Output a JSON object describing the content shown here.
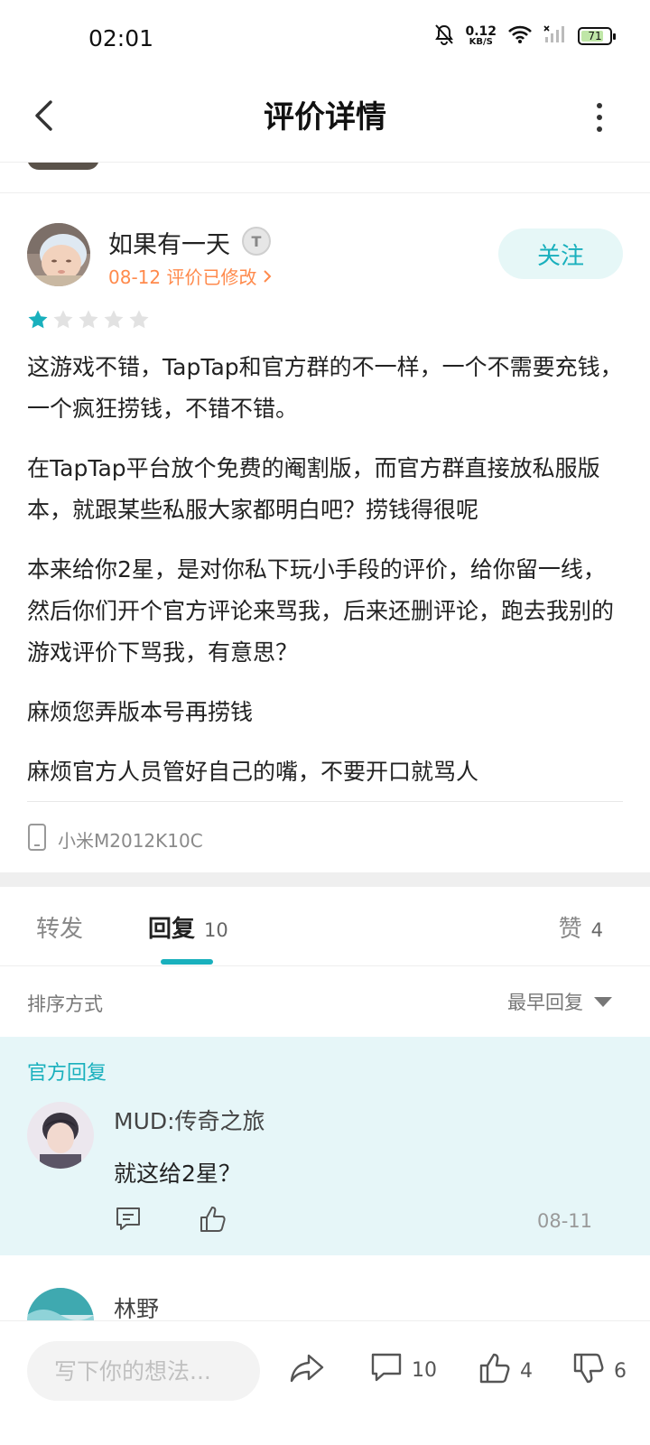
{
  "status_bar": {
    "time": "02:01",
    "net_speed": "0.12",
    "net_unit": "KB/S",
    "battery": "71"
  },
  "header": {
    "title": "评价详情",
    "icons": {
      "back": "chevron-left-icon",
      "more": "vertical-dots-icon"
    }
  },
  "review": {
    "author": "如果有一天",
    "badge": "T",
    "meta": "08-12 评价已修改",
    "follow_label": "关注",
    "rating": 1,
    "rating_max": 5,
    "paragraphs": [
      "这游戏不错，TapTap和官方群的不一样，一个不需要充钱，一个疯狂捞钱，不错不错。",
      "在TapTap平台放个免费的阉割版，而官方群直接放私服版本，就跟某些私服大家都明白吧？捞钱得很呢",
      "本来给你2星，是对你私下玩小手段的评价，给你留一线，然后你们开个官方评论来骂我，后来还删评论，跑去我别的游戏评价下骂我，有意思？",
      "麻烦您弄版本号再捞钱",
      "麻烦官方人员管好自己的嘴，不要开口就骂人"
    ],
    "device": "小米M2012K10C"
  },
  "tabs": {
    "forward": "转发",
    "reply": "回复",
    "reply_count": "10",
    "like": "赞",
    "like_count": "4"
  },
  "sort": {
    "label": "排序方式",
    "selected": "最早回复"
  },
  "official_reply": {
    "tag": "官方回复",
    "name": "MUD:传奇之旅",
    "text": "就这给2星？",
    "date": "08-11"
  },
  "next_reply": {
    "name": "林野"
  },
  "bottom_bar": {
    "placeholder": "写下你的想法...",
    "comments": "10",
    "likes": "4",
    "dislikes": "6"
  },
  "colors": {
    "accent": "#19b0bd",
    "meta_orange": "#ff8a4c",
    "official_bg": "#e6f6f8"
  }
}
